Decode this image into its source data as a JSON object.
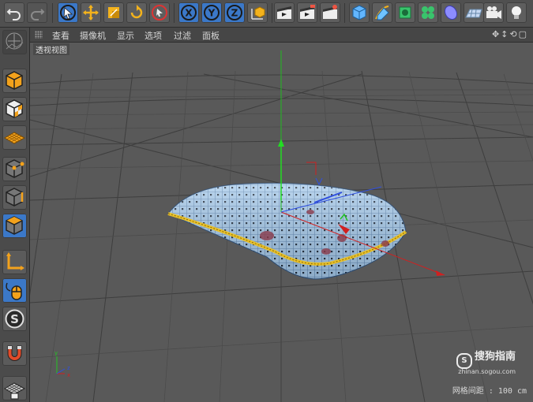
{
  "menu": {
    "items": [
      "查看",
      "摄像机",
      "显示",
      "选项",
      "过滤",
      "面板"
    ]
  },
  "viewport": {
    "label": "透视视图",
    "grid_spacing": "网格间距 : 100 cm"
  },
  "watermark": {
    "logo": "S",
    "main": "搜狗指南",
    "sub": "zhinan.sogou.com"
  },
  "toolbar": {
    "axis_x": "X",
    "axis_y": "Y",
    "axis_z": "Z"
  },
  "sidebar": {
    "snap_letter": "S"
  },
  "colors": {
    "accent_blue": "#3b78c8",
    "axis_x": "#d02020",
    "axis_y": "#22c222",
    "axis_z": "#3050e0",
    "pillow": "#9cc3e6",
    "piping": "#e8c12a"
  }
}
